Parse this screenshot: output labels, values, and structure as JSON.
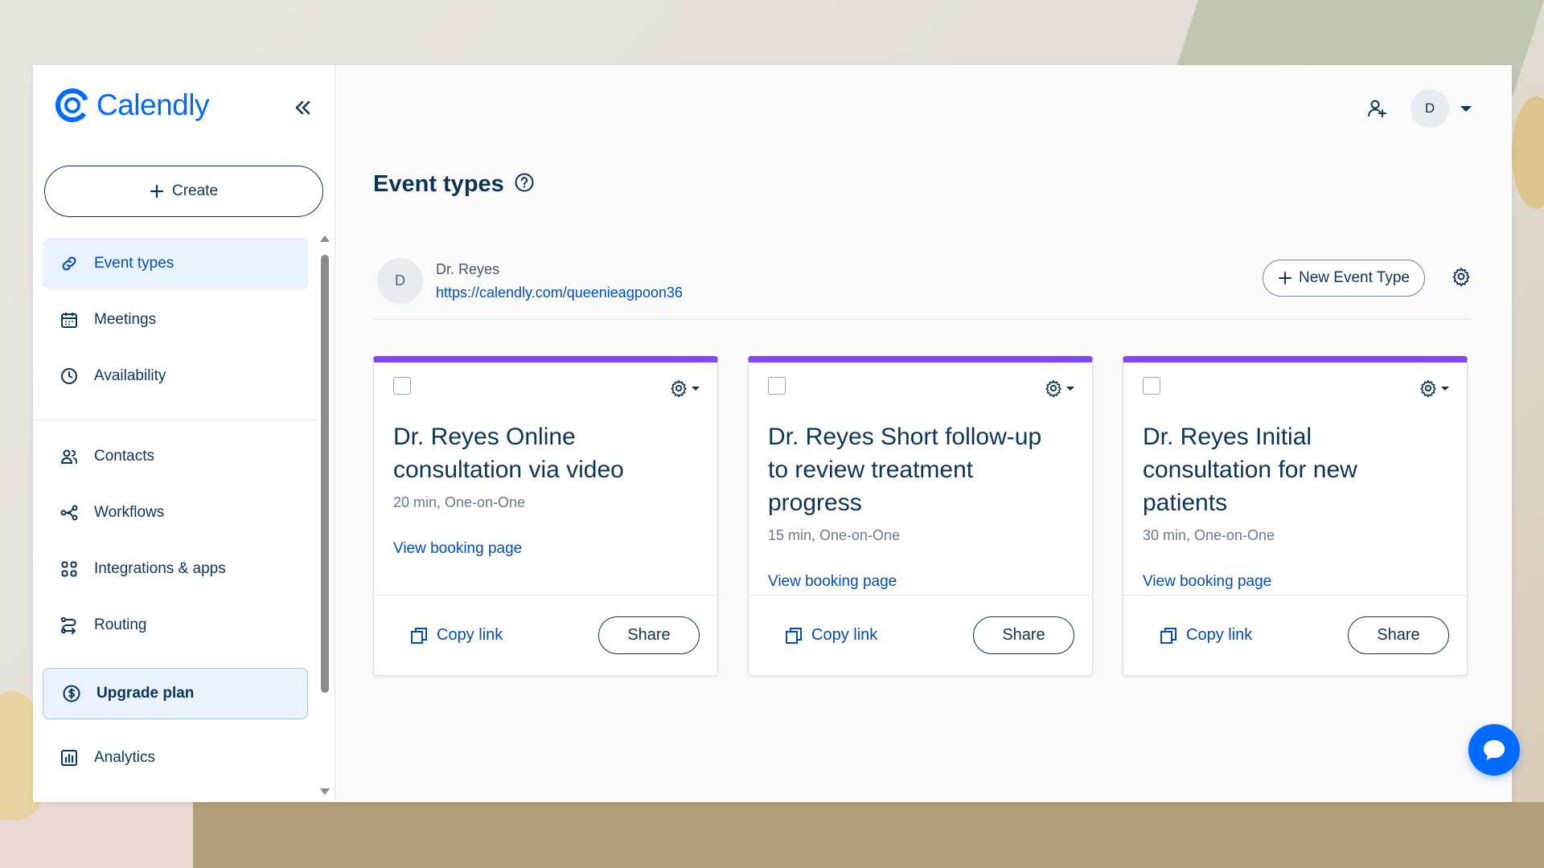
{
  "app": {
    "brand_name": "Calendly",
    "accent_color": "#006bff",
    "event_color": "#8247f5"
  },
  "sidebar": {
    "create_label": "Create",
    "items": [
      {
        "label": "Event types",
        "icon": "link-icon",
        "active": true
      },
      {
        "label": "Meetings",
        "icon": "calendar-icon"
      },
      {
        "label": "Availability",
        "icon": "clock-icon"
      },
      {
        "label": "Contacts",
        "icon": "contacts-icon"
      },
      {
        "label": "Workflows",
        "icon": "workflow-icon"
      },
      {
        "label": "Integrations & apps",
        "icon": "grid-icon"
      },
      {
        "label": "Routing",
        "icon": "routing-icon"
      }
    ],
    "upgrade_label": "Upgrade plan",
    "analytics_label": "Analytics"
  },
  "header": {
    "avatar_initial": "D"
  },
  "main": {
    "title": "Event types",
    "owner": {
      "initial": "D",
      "name": "Dr. Reyes",
      "link": "https://calendly.com/queenieagpoon36"
    },
    "new_event_type_label": "New Event Type",
    "cards": [
      {
        "title": "Dr. Reyes Online consultation via video",
        "meta": "20 min, One-on-One",
        "view_label": "View booking page",
        "copy_label": "Copy link",
        "share_label": "Share"
      },
      {
        "title": "Dr. Reyes Short follow-up to review treatment progress",
        "meta": "15 min, One-on-One",
        "view_label": "View booking page",
        "copy_label": "Copy link",
        "share_label": "Share"
      },
      {
        "title": "Dr. Reyes Initial consultation for new patients",
        "meta": "30 min, One-on-One",
        "view_label": "View booking page",
        "copy_label": "Copy link",
        "share_label": "Share"
      }
    ]
  }
}
